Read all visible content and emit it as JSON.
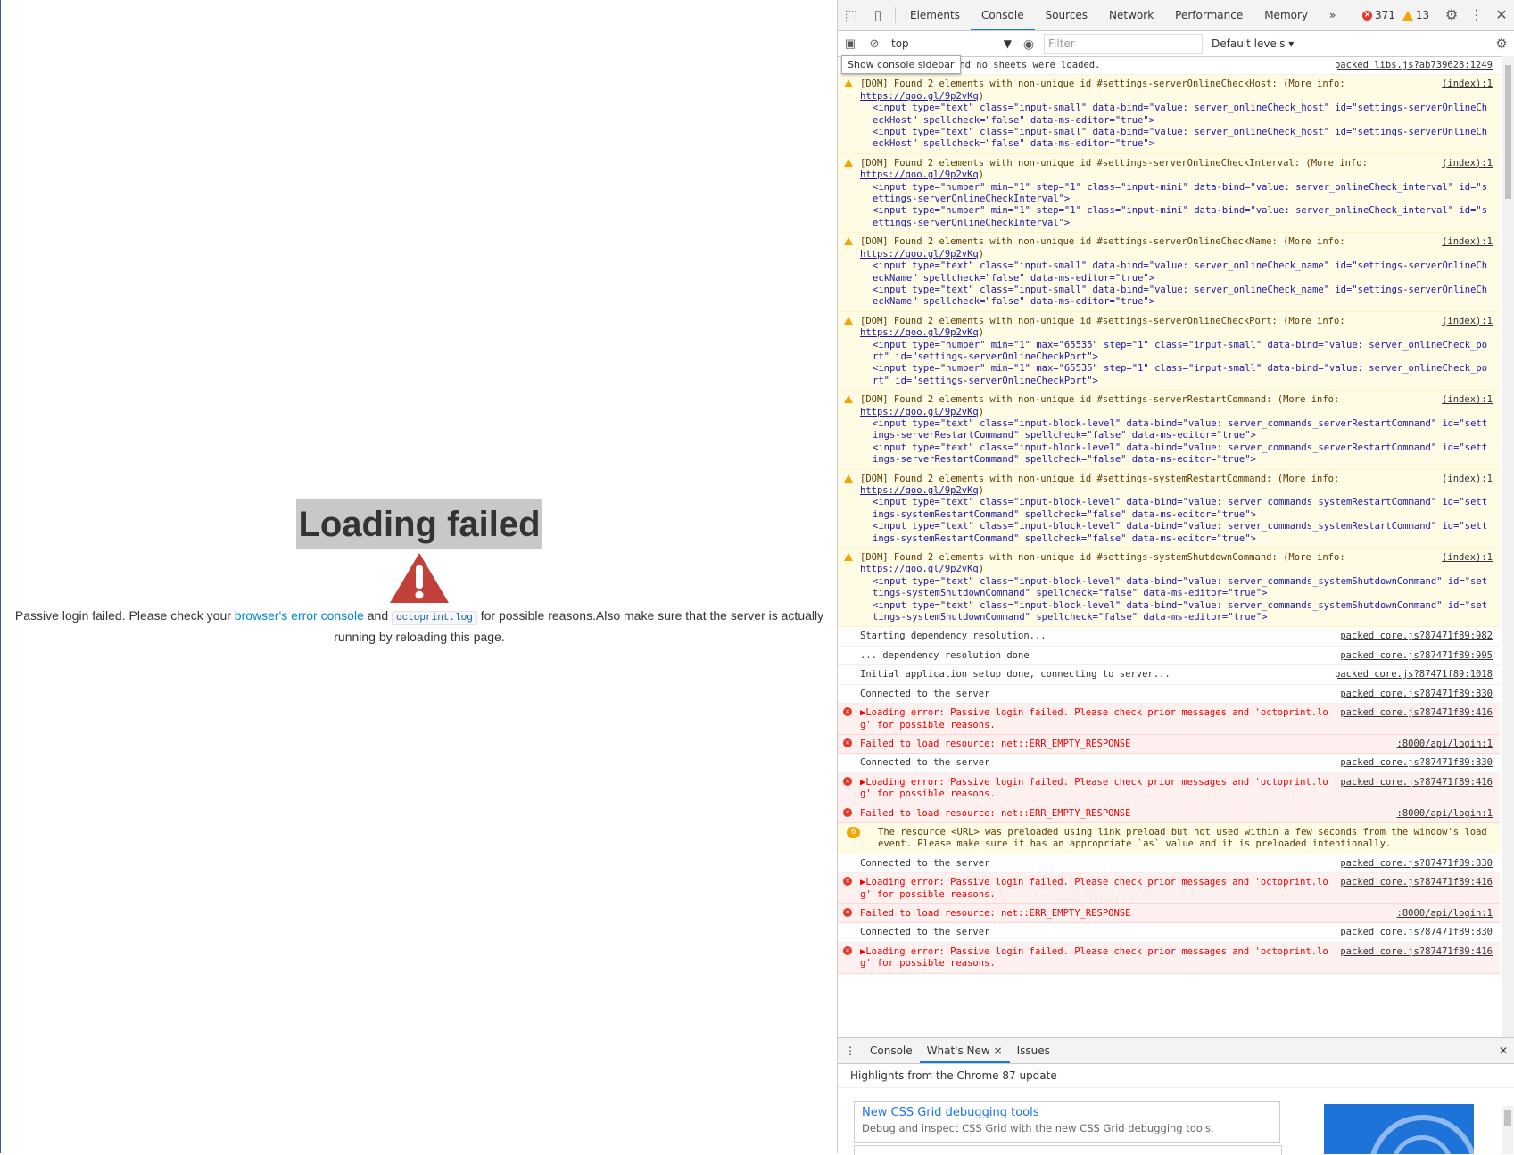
{
  "page": {
    "title": "Loading failed",
    "message_before_link": "Passive login failed. Please check your ",
    "link_label": "browser's error console",
    "message_and": " and ",
    "code_label": "octoprint.log",
    "message_after": " for possible reasons.Also make sure that the server is actually running by reloading this page."
  },
  "devtools": {
    "tabs": [
      "Elements",
      "Console",
      "Sources",
      "Network",
      "Performance",
      "Memory"
    ],
    "more_tabs": "»",
    "error_count": "371",
    "warning_count": "13",
    "context": "top",
    "filter_placeholder": "Filter",
    "levels": "Default levels",
    "tooltip": "Show console sidebar",
    "colors": {
      "accent": "#1a73e8",
      "error": "#e4382b",
      "warning": "#f2a600"
    }
  },
  "console": {
    "first_line": {
      "text": "and no sheets were loaded.",
      "src": "packed libs.js?ab739628:1249"
    },
    "warnings": [
      {
        "text": "[DOM] Found 2 elements with non-unique id #settings-serverOnlineCheckHost: (More info: ",
        "url": "https://goo.gl/9p2vKq",
        "src": "(index):1",
        "lines": [
          "<input type=\"text\" class=\"input-small\" data-bind=\"value: server_onlineCheck_host\" id=\"settings-serverOnlineCheckHost\" spellcheck=\"false\" data-ms-editor=\"true\">",
          "<input type=\"text\" class=\"input-small\" data-bind=\"value: server_onlineCheck_host\" id=\"settings-serverOnlineCheckHost\" spellcheck=\"false\" data-ms-editor=\"true\">"
        ]
      },
      {
        "text": "[DOM] Found 2 elements with non-unique id #settings-serverOnlineCheckInterval: (More info: ",
        "url": "https://goo.gl/9p2vKq",
        "src": "(index):1",
        "lines": [
          "<input type=\"number\" min=\"1\" step=\"1\" class=\"input-mini\" data-bind=\"value: server_onlineCheck_interval\" id=\"settings-serverOnlineCheckInterval\">",
          "<input type=\"number\" min=\"1\" step=\"1\" class=\"input-mini\" data-bind=\"value: server_onlineCheck_interval\" id=\"settings-serverOnlineCheckInterval\">"
        ]
      },
      {
        "text": "[DOM] Found 2 elements with non-unique id #settings-serverOnlineCheckName: (More info: ",
        "url": "https://goo.gl/9p2vKq",
        "src": "(index):1",
        "lines": [
          "<input type=\"text\" class=\"input-small\" data-bind=\"value: server_onlineCheck_name\" id=\"settings-serverOnlineCheckName\" spellcheck=\"false\" data-ms-editor=\"true\">",
          "<input type=\"text\" class=\"input-small\" data-bind=\"value: server_onlineCheck_name\" id=\"settings-serverOnlineCheckName\" spellcheck=\"false\" data-ms-editor=\"true\">"
        ]
      },
      {
        "text": "[DOM] Found 2 elements with non-unique id #settings-serverOnlineCheckPort: (More info: ",
        "url": "https://goo.gl/9p2vKq",
        "src": "(index):1",
        "lines": [
          "<input type=\"number\" min=\"1\" max=\"65535\" step=\"1\" class=\"input-small\" data-bind=\"value: server_onlineCheck_port\" id=\"settings-serverOnlineCheckPort\">",
          "<input type=\"number\" min=\"1\" max=\"65535\" step=\"1\" class=\"input-small\" data-bind=\"value: server_onlineCheck_port\" id=\"settings-serverOnlineCheckPort\">"
        ]
      },
      {
        "text": "[DOM] Found 2 elements with non-unique id #settings-serverRestartCommand: (More info: ",
        "url": "https://goo.gl/9p2vKq",
        "src": "(index):1",
        "lines": [
          "<input type=\"text\" class=\"input-block-level\" data-bind=\"value: server_commands_serverRestartCommand\" id=\"settings-serverRestartCommand\" spellcheck=\"false\" data-ms-editor=\"true\">",
          "<input type=\"text\" class=\"input-block-level\" data-bind=\"value: server_commands_serverRestartCommand\" id=\"settings-serverRestartCommand\" spellcheck=\"false\" data-ms-editor=\"true\">"
        ]
      },
      {
        "text": "[DOM] Found 2 elements with non-unique id #settings-systemRestartCommand: (More info: ",
        "url": "https://goo.gl/9p2vKq",
        "src": "(index):1",
        "lines": [
          "<input type=\"text\" class=\"input-block-level\" data-bind=\"value: server_commands_systemRestartCommand\" id=\"settings-systemRestartCommand\" spellcheck=\"false\" data-ms-editor=\"true\">",
          "<input type=\"text\" class=\"input-block-level\" data-bind=\"value: server_commands_systemRestartCommand\" id=\"settings-systemRestartCommand\" spellcheck=\"false\" data-ms-editor=\"true\">"
        ]
      },
      {
        "text": "[DOM] Found 2 elements with non-unique id #settings-systemShutdownCommand: (More info: ",
        "url": "https://goo.gl/9p2vKq",
        "src": "(index):1",
        "lines": [
          "<input type=\"text\" class=\"input-block-level\" data-bind=\"value: server_commands_systemShutdownCommand\" id=\"settings-systemShutdownCommand\" spellcheck=\"false\" data-ms-editor=\"true\">",
          "<input type=\"text\" class=\"input-block-level\" data-bind=\"value: server_commands_systemShutdownCommand\" id=\"settings-systemShutdownCommand\" spellcheck=\"false\" data-ms-editor=\"true\">"
        ]
      }
    ],
    "log": [
      {
        "kind": "info",
        "text": "Starting dependency resolution...",
        "src": "packed core.js?87471f89:982"
      },
      {
        "kind": "info",
        "text": "... dependency resolution done",
        "src": "packed core.js?87471f89:995"
      },
      {
        "kind": "info",
        "text": "Initial application setup done, connecting to server...",
        "src": "packed core.js?87471f89:1018"
      },
      {
        "kind": "info",
        "text": "Connected to the server",
        "src": "packed core.js?87471f89:830"
      },
      {
        "kind": "err",
        "text": "▶Loading error: Passive login failed. Please check prior messages and 'octoprint.log' for possible reasons.",
        "src": "packed core.js?87471f89:416"
      },
      {
        "kind": "err",
        "text": "Failed to load resource: net::ERR_EMPTY_RESPONSE",
        "src": ":8000/api/login:1"
      },
      {
        "kind": "info",
        "text": "Connected to the server",
        "src": "packed core.js?87471f89:830"
      },
      {
        "kind": "err",
        "text": "▶Loading error: Passive login failed. Please check prior messages and 'octoprint.log' for possible reasons.",
        "src": "packed core.js?87471f89:416"
      },
      {
        "kind": "err",
        "text": "Failed to load resource: net::ERR_EMPTY_RESPONSE",
        "src": ":8000/api/login:1"
      },
      {
        "kind": "warn6",
        "badge": "6",
        "text": "The resource <URL> was preloaded using link preload but not used within a few seconds from the window's load event. Please make sure it has an appropriate `as` value and it is preloaded intentionally.",
        "src": ""
      },
      {
        "kind": "info",
        "text": "Connected to the server",
        "src": "packed core.js?87471f89:830"
      },
      {
        "kind": "err",
        "text": "▶Loading error: Passive login failed. Please check prior messages and 'octoprint.log' for possible reasons.",
        "src": "packed core.js?87471f89:416"
      },
      {
        "kind": "err",
        "text": "Failed to load resource: net::ERR_EMPTY_RESPONSE",
        "src": ":8000/api/login:1"
      },
      {
        "kind": "info",
        "text": "Connected to the server",
        "src": "packed core.js?87471f89:830"
      },
      {
        "kind": "err",
        "text": "▶Loading error: Passive login failed. Please check prior messages and 'octoprint.log' for possible reasons.",
        "src": "packed core.js?87471f89:416"
      }
    ]
  },
  "drawer": {
    "tabs": [
      "Console",
      "What's New",
      "Issues"
    ],
    "heading": "Highlights from the Chrome 87 update",
    "card_title": "New CSS Grid debugging tools",
    "card_desc": "Debug and inspect CSS Grid with the new CSS Grid debugging tools."
  }
}
